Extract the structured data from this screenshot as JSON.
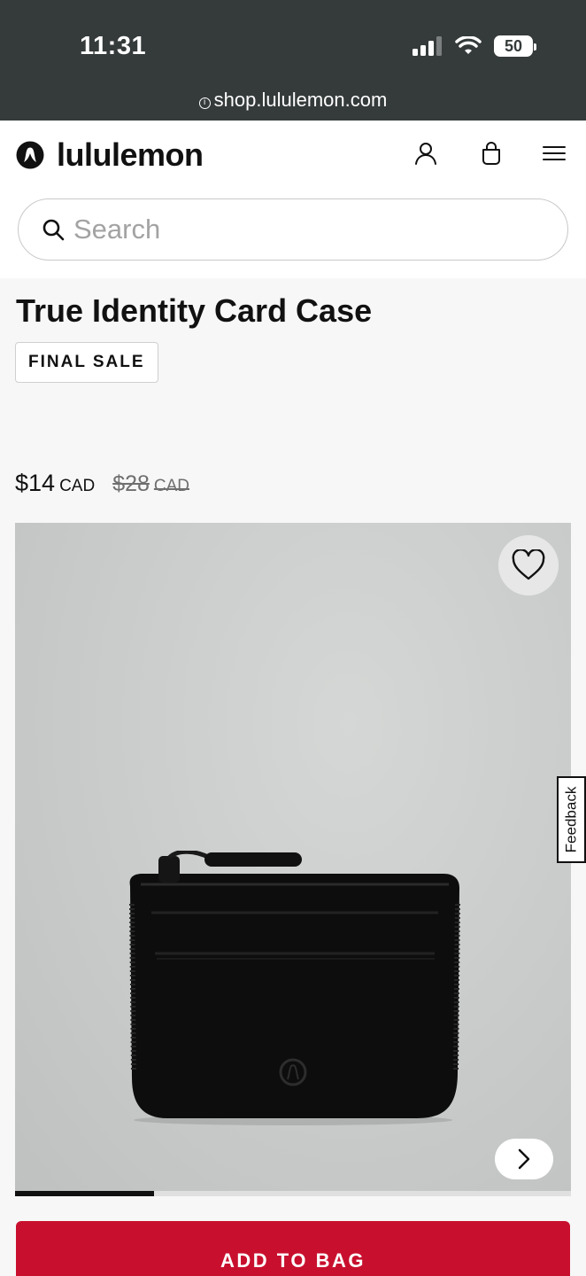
{
  "status_bar": {
    "time": "11:31",
    "battery": "50"
  },
  "browser": {
    "url": "shop.lululemon.com"
  },
  "header": {
    "brand": "lululemon"
  },
  "search": {
    "placeholder": "Search"
  },
  "product": {
    "title": "True Identity Card Case",
    "badge": "FINAL SALE",
    "price_now": "$14",
    "price_now_currency": "CAD",
    "price_was": "$28",
    "price_was_currency": "CAD"
  },
  "gallery": {
    "progress": 0.25
  },
  "feedback": {
    "label": "Feedback"
  },
  "cta": {
    "add_to_bag": "ADD TO BAG"
  },
  "colors": {
    "accent": "#c8102e",
    "status_bar": "#353a3a"
  }
}
